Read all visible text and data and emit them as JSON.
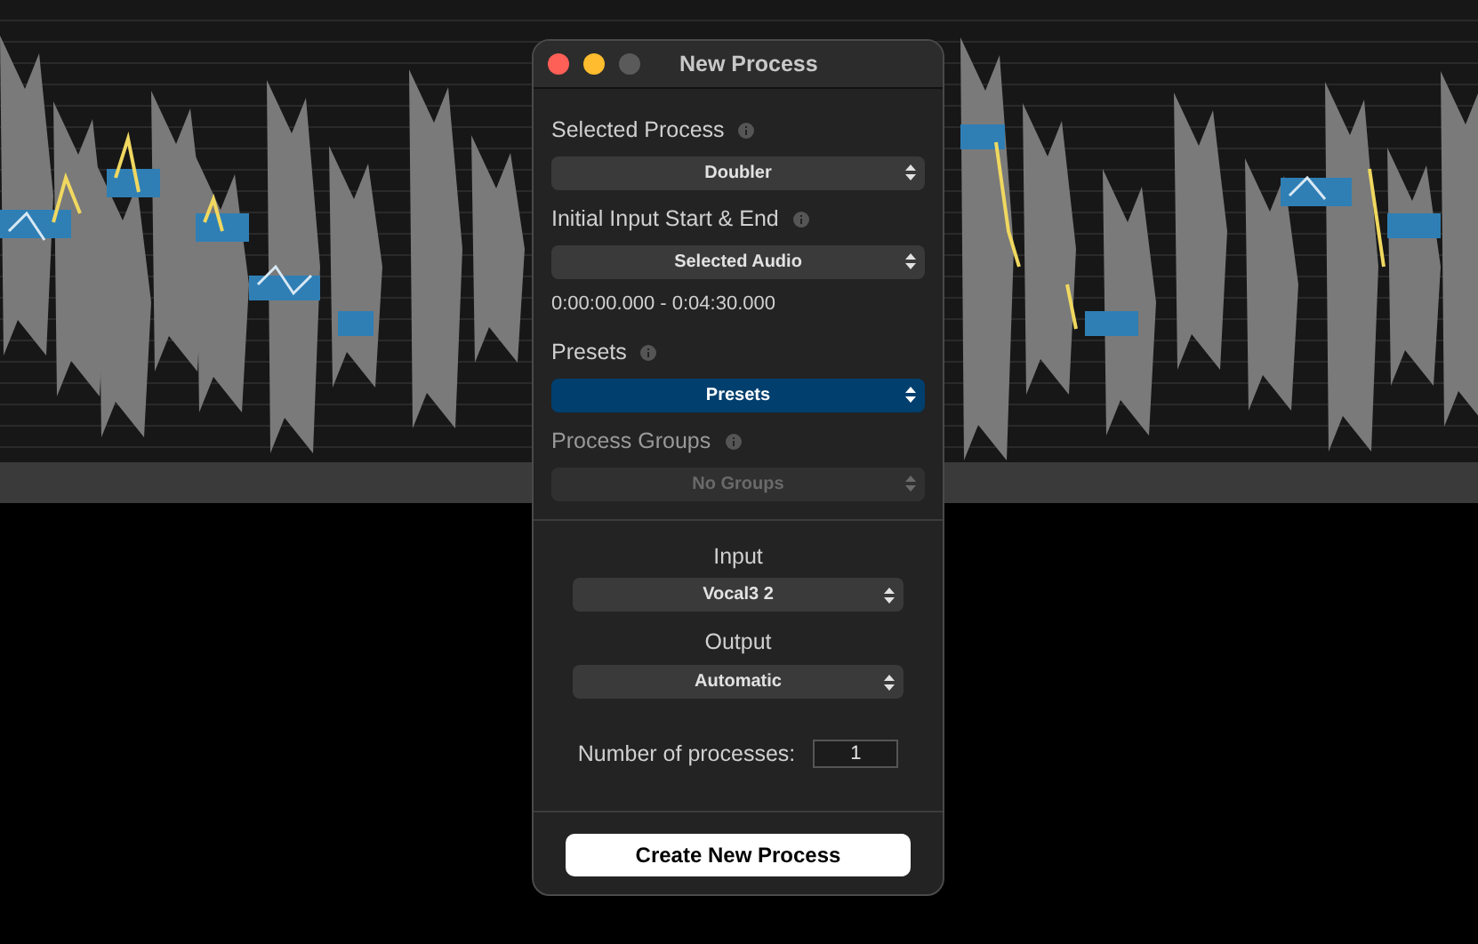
{
  "window": {
    "title": "New Process"
  },
  "fields": [
    {
      "label": "Selected Process",
      "popup": {
        "value": "Doubler",
        "highlighted": false,
        "disabled": false
      }
    },
    {
      "label": "Initial Input Start & End",
      "popup": {
        "value": "Selected Audio",
        "highlighted": false,
        "disabled": false
      },
      "range": "0:00:00.000 - 0:04:30.000"
    },
    {
      "label": "Presets",
      "popup": {
        "value": "Presets",
        "highlighted": true,
        "disabled": false
      }
    },
    {
      "label": "Process Groups",
      "popup": {
        "value": "No Groups",
        "highlighted": false,
        "disabled": true
      }
    }
  ],
  "routing": [
    {
      "label": "Input",
      "value": "Vocal3 2"
    },
    {
      "label": "Output",
      "value": "Automatic"
    }
  ],
  "count": {
    "label": "Number of processes:",
    "value": "1"
  },
  "button": "Create New Process"
}
